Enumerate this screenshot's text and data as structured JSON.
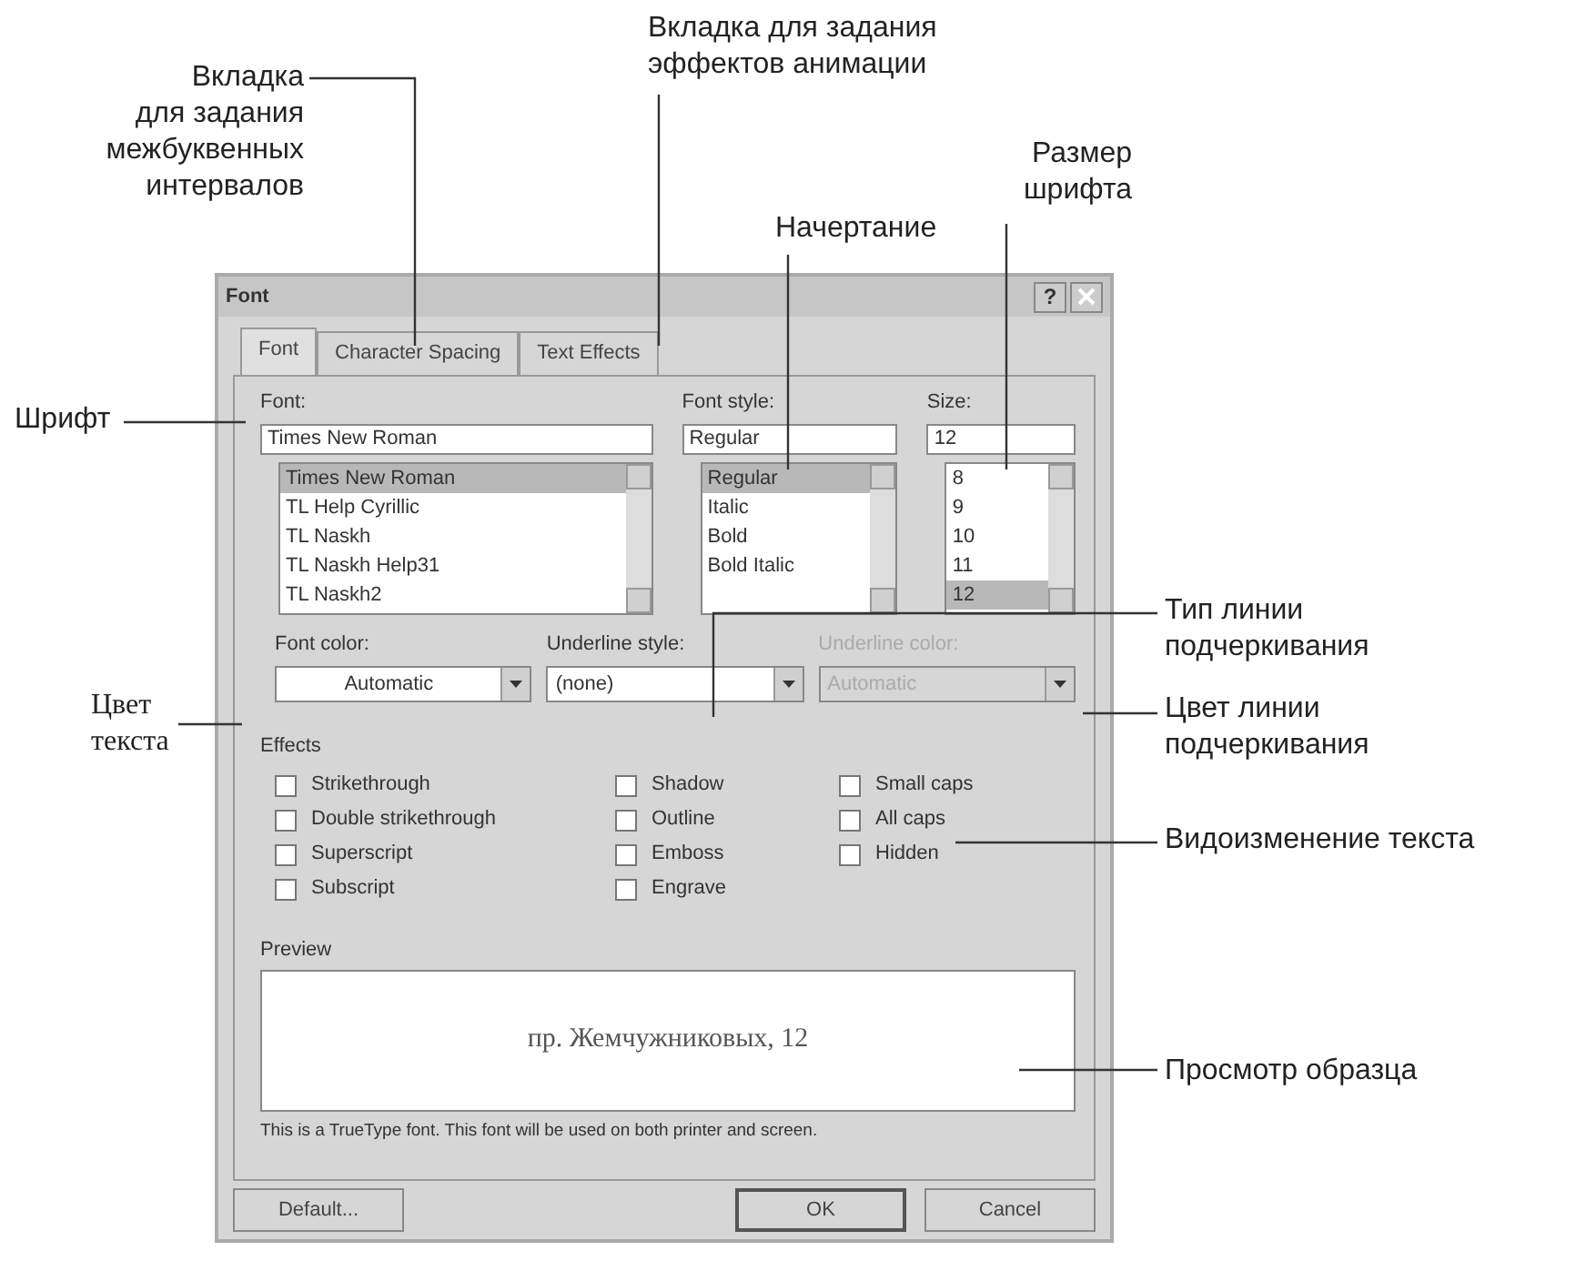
{
  "callouts": [
    {
      "text": "Вкладка\nдля задания\nмежбуквенных\nинтервалов"
    },
    {
      "text": "Вкладка для задания\nэффектов анимации"
    },
    {
      "text": "Размер\nшрифта"
    },
    {
      "text": "Начертание"
    },
    {
      "text": "Шрифт"
    },
    {
      "text": "Тип линии\nподчеркивания"
    },
    {
      "text": "Цвет\nтекста"
    },
    {
      "text": "Цвет линии\nподчеркивания"
    },
    {
      "text": "Видоизменение текста"
    },
    {
      "text": "Просмотр образца"
    }
  ],
  "dialog": {
    "title": "Font",
    "help_button": "?",
    "tabs": [
      {
        "label": "Font",
        "selected": true
      },
      {
        "label": "Character Spacing",
        "selected": false
      },
      {
        "label": "Text Effects",
        "selected": false
      }
    ],
    "font": {
      "label": "Font:",
      "value": "Times New Roman",
      "items": [
        {
          "label": "Times New Roman",
          "selected": true
        },
        {
          "label": "TL Help Cyrillic",
          "selected": false
        },
        {
          "label": "TL Naskh",
          "selected": false
        },
        {
          "label": "TL Naskh Help31",
          "selected": false
        },
        {
          "label": "TL Naskh2",
          "selected": false
        }
      ]
    },
    "font_style": {
      "label": "Font style:",
      "value": "Regular",
      "items": [
        {
          "label": "Regular",
          "selected": true
        },
        {
          "label": "Italic",
          "selected": false
        },
        {
          "label": "Bold",
          "selected": false
        },
        {
          "label": "Bold Italic",
          "selected": false
        }
      ]
    },
    "size": {
      "label": "Size:",
      "value": "12",
      "items": [
        {
          "label": "8",
          "selected": false
        },
        {
          "label": "9",
          "selected": false
        },
        {
          "label": "10",
          "selected": false
        },
        {
          "label": "11",
          "selected": false
        },
        {
          "label": "12",
          "selected": true
        }
      ]
    },
    "dropdowns": [
      {
        "label": "Font color:",
        "value": "Automatic",
        "disabled": false
      },
      {
        "label": "Underline style:",
        "value": "(none)",
        "disabled": false
      },
      {
        "label": "Underline color:",
        "value": "Automatic",
        "disabled": true
      }
    ],
    "effects_label": "Effects",
    "effects": [
      [
        {
          "label": "Strikethrough",
          "checked": false
        },
        {
          "label": "Double strikethrough",
          "checked": false
        },
        {
          "label": "Superscript",
          "checked": false
        },
        {
          "label": "Subscript",
          "checked": false
        }
      ],
      [
        {
          "label": "Shadow",
          "checked": false
        },
        {
          "label": "Outline",
          "checked": false
        },
        {
          "label": "Emboss",
          "checked": false
        },
        {
          "label": "Engrave",
          "checked": false
        }
      ],
      [
        {
          "label": "Small caps",
          "checked": false
        },
        {
          "label": "All caps",
          "checked": false
        },
        {
          "label": "Hidden",
          "checked": false
        }
      ]
    ],
    "preview": {
      "label": "Preview",
      "text": "пр. Жемчужниковых, 12"
    },
    "note": "This is a TrueType font. This font will be used on both printer and screen.",
    "buttons": [
      {
        "label": "Default...",
        "default": false
      },
      {
        "label": "OK",
        "default": true
      },
      {
        "label": "Cancel",
        "default": false
      }
    ]
  }
}
